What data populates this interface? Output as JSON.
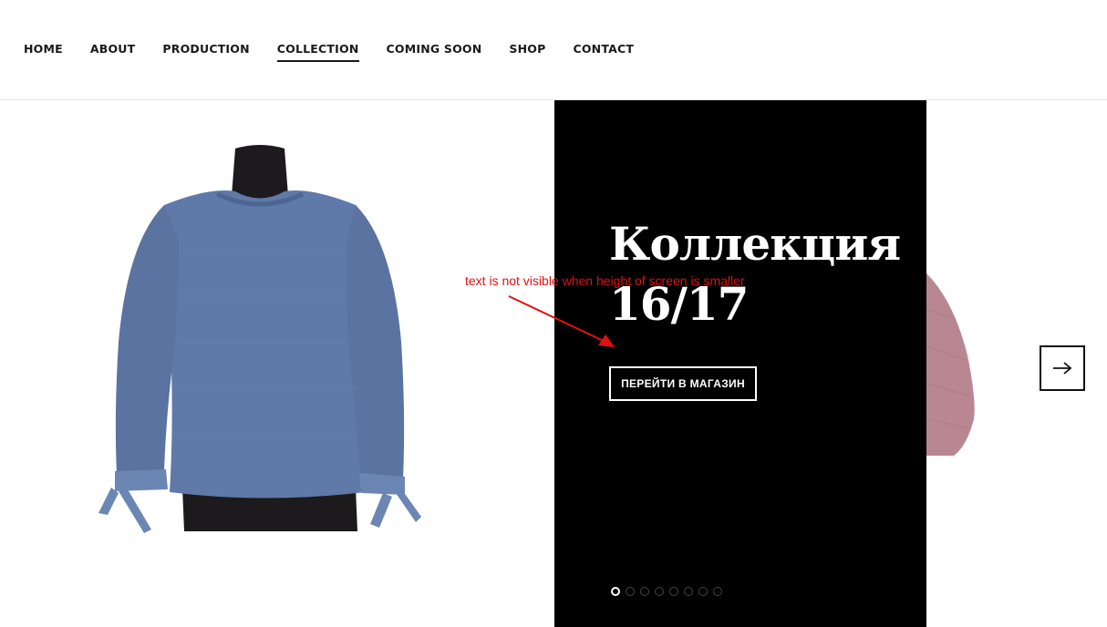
{
  "nav": {
    "items": [
      {
        "label": "HOME",
        "active": false
      },
      {
        "label": "ABOUT",
        "active": false
      },
      {
        "label": "PRODUCTION",
        "active": false
      },
      {
        "label": "COLLECTION",
        "active": true
      },
      {
        "label": "COMING SOON",
        "active": false
      },
      {
        "label": "SHOP",
        "active": false
      },
      {
        "label": "CONTACT",
        "active": false
      }
    ]
  },
  "slide": {
    "title_line1": "Коллекция",
    "title_line2": "16/17",
    "button_label": "ПЕРЕЙТИ В МАГАЗИН",
    "dots_count": 8,
    "active_dot": 1
  },
  "annotation": {
    "text": "text is not visible when height of screen is smaller",
    "color": "#e01010"
  },
  "colors": {
    "sweater_blue": "#5f79a8",
    "sweater_pink": "#b98792",
    "panel_black": "#000000"
  },
  "icons": {
    "next": "arrow-right-icon"
  }
}
